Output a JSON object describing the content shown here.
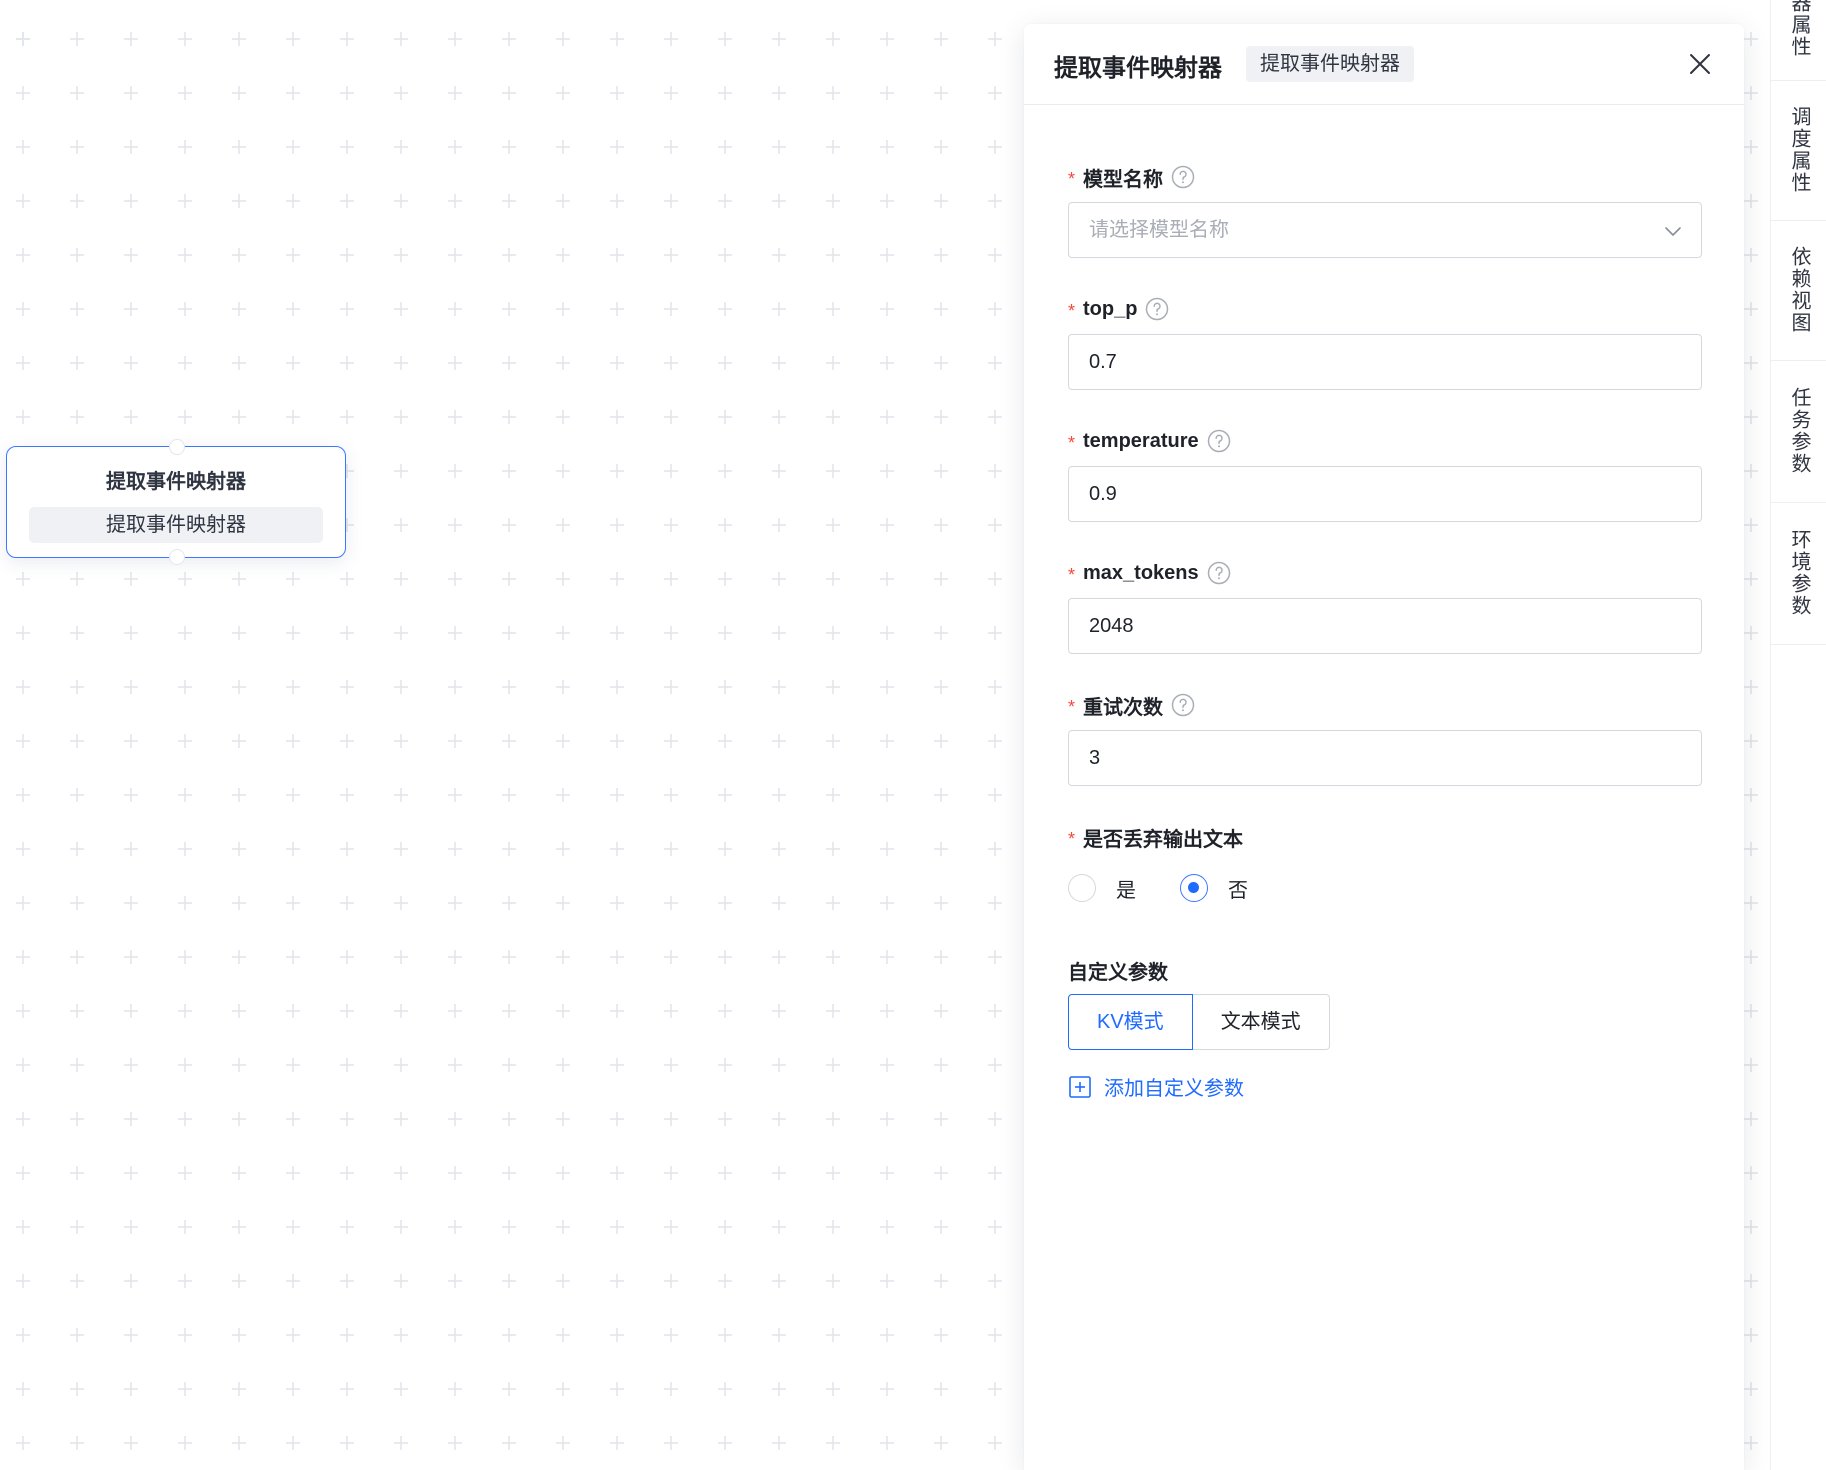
{
  "canvas": {
    "node": {
      "title": "提取事件映射器",
      "tag": "提取事件映射器"
    }
  },
  "drawer": {
    "title": "提取事件映射器",
    "tag": "提取事件映射器",
    "fields": {
      "model_name": {
        "label": "模型名称",
        "placeholder": "请选择模型名称",
        "required": true
      },
      "top_p": {
        "label": "top_p",
        "value": "0.7",
        "required": true
      },
      "temperature": {
        "label": "temperature",
        "value": "0.9",
        "required": true
      },
      "max_tokens": {
        "label": "max_tokens",
        "value": "2048",
        "required": true
      },
      "retry": {
        "label": "重试次数",
        "value": "3",
        "required": true
      },
      "discard": {
        "label": "是否丢弃输出文本",
        "required": true,
        "options": [
          {
            "label": "是",
            "checked": false
          },
          {
            "label": "否",
            "checked": true
          }
        ]
      }
    },
    "custom_params": {
      "title": "自定义参数",
      "modes": [
        {
          "label": "KV模式",
          "active": true
        },
        {
          "label": "文本模式",
          "active": false
        }
      ],
      "add_label": "添加自定义参数"
    },
    "required_mark": "*"
  },
  "side_tabs": [
    {
      "label": "器属性"
    },
    {
      "label": "调度属性"
    },
    {
      "label": "依赖视图"
    },
    {
      "label": "任务参数"
    },
    {
      "label": "环境参数"
    }
  ],
  "colors": {
    "accent": "#1f6bff",
    "required": "#f5483b",
    "node_border": "#3a78ff"
  }
}
